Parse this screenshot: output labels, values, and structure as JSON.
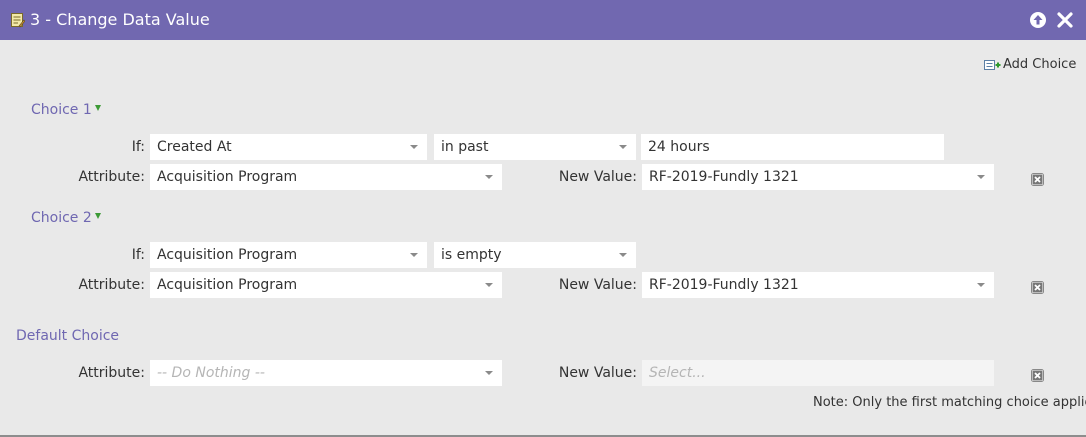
{
  "window": {
    "title": "3 - Change Data Value",
    "title_icon": "document-edit-icon",
    "collapse_icon": "arrow-up-circle-icon",
    "close_icon": "close-x-icon"
  },
  "toolbar": {
    "add_choice_label": "Add Choice",
    "add_choice_icon": "add-choice-icon"
  },
  "choices": [
    {
      "heading": "Choice 1",
      "if_label": "If:",
      "if_field": "Created At",
      "operator": "in past",
      "if_value": "24 hours",
      "attribute_label": "Attribute:",
      "attribute": "Acquisition Program",
      "new_value_label": "New Value:",
      "new_value": "RF-2019-Fundly 1321"
    },
    {
      "heading": "Choice 2",
      "if_label": "If:",
      "if_field": "Acquisition Program",
      "operator": "is empty",
      "attribute_label": "Attribute:",
      "attribute": "Acquisition Program",
      "new_value_label": "New Value:",
      "new_value": "RF-2019-Fundly 1321"
    }
  ],
  "default_choice": {
    "heading": "Default Choice",
    "attribute_label": "Attribute:",
    "attribute_placeholder": "-- Do Nothing --",
    "new_value_label": "New Value:",
    "new_value_placeholder": "Select..."
  },
  "note": "Note: Only the first matching choice applies",
  "colors": {
    "titlebar": "#7168b0",
    "section_heading": "#6f67b1",
    "background": "#e9e9e9",
    "arrow_green": "#3c9a35"
  }
}
